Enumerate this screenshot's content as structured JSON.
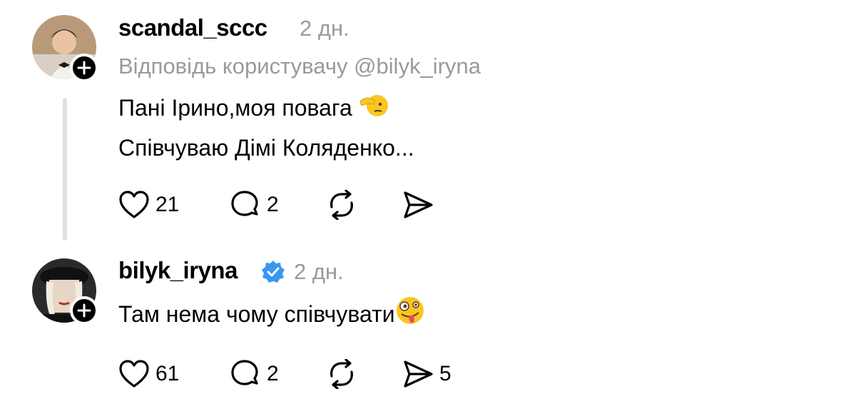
{
  "comments": [
    {
      "username": "scandal_sccc",
      "time": "2 дн.",
      "reply_to": "Відповідь користувачу @bilyk_iryna",
      "line1": "Пані Ірино,моя повага",
      "line2": "Співчуваю Дімі Коляденко...",
      "likes": "21",
      "replies": "2",
      "emoji": "saluting-face",
      "verified": false
    },
    {
      "username": "bilyk_iryna",
      "time": "2 дн.",
      "line1": "Там нема чому співчувати",
      "likes": "61",
      "replies": "2",
      "shares": "5",
      "emoji": "zany-face",
      "verified": true,
      "verified_color": "#3897f0"
    }
  ]
}
